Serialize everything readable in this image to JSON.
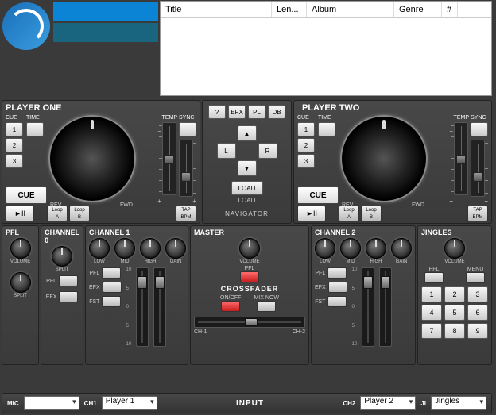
{
  "library": {
    "columns": [
      "Title",
      "Len...",
      "Album",
      "Genre",
      "#"
    ]
  },
  "deck": {
    "p1_title": "PLAYER ONE",
    "p2_title": "PLAYER TWO",
    "cue_lbl": "CUE",
    "time_lbl": "TIME",
    "temp_lbl": "TEMP",
    "sync_lbl": "SYNC",
    "cuebtns": [
      "1",
      "2",
      "3"
    ],
    "bigcue": "CUE",
    "play": "►II",
    "loopA": "Loop\nA",
    "loopB": "Loop\nB",
    "tap": "TAP\nBPM",
    "rev": "REV",
    "fwd": "FWD",
    "plus": "+",
    "minus": "−"
  },
  "nav": {
    "title": "NAVIGATOR",
    "btns": [
      "?",
      "EFX",
      "PL",
      "DB"
    ],
    "up": "▲",
    "down": "▼",
    "left": "L",
    "right": "R",
    "load": "LOAD",
    "load_lbl": "LOAD"
  },
  "mixer": {
    "pfl_title": "PFL",
    "ch0_title": "CHANNEL 0",
    "ch1_title": "CHANNEL 1",
    "ch2_title": "CHANNEL 2",
    "master_title": "MASTER",
    "jingles_title": "JINGLES",
    "volume_lbl": "VOLUME",
    "split_lbl": "SPLIT",
    "low": "LOW",
    "mid": "MID",
    "high": "HIGH",
    "gain": "GAIN",
    "pfl": "PFL",
    "efx": "EFX",
    "fst": "FST",
    "menu": "MENU",
    "crossfader": "CROSSFADER",
    "onoff": "ON/OFF",
    "mixnow": "MIX NOW",
    "ch1lbl": "CH-1",
    "ch2lbl": "CH-2",
    "ticks": [
      "10",
      "5",
      "0",
      "5",
      "10"
    ],
    "jingles": [
      "1",
      "2",
      "3",
      "4",
      "5",
      "6",
      "7",
      "8",
      "9"
    ]
  },
  "input": {
    "mic": "MIC",
    "ch1": "CH1",
    "ch2": "CH2",
    "ji": "JI",
    "title": "INPUT",
    "mic_val": "",
    "ch1_val": "Player 1",
    "ch2_val": "Player 2",
    "ji_val": "Jingles"
  }
}
